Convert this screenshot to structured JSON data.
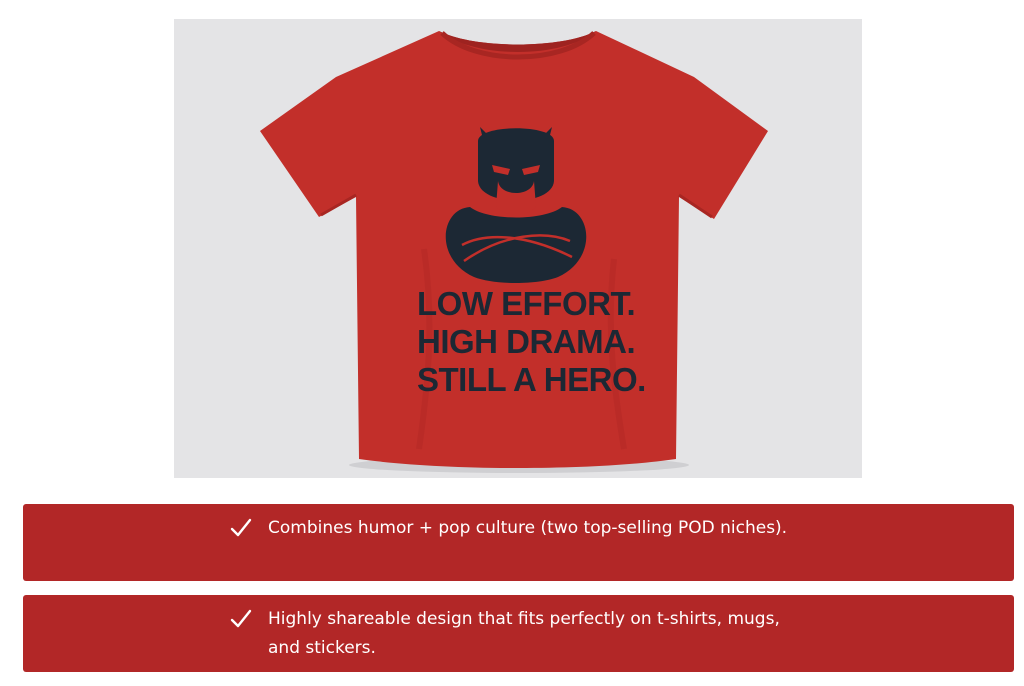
{
  "product": {
    "image_icon": "tshirt-mockup",
    "shirt_color": "#c22f2a",
    "print_color": "#1c2834",
    "print_lines": [
      "LOW EFFORT.",
      "HIGH DRAMA.",
      "STILL A HERO."
    ]
  },
  "features": [
    {
      "icon": "checkmark-icon",
      "text": "Combines humor + pop culture (two top-selling POD niches)."
    },
    {
      "icon": "checkmark-icon",
      "text": "Highly shareable design that fits perfectly on t-shirts, mugs, and stickers."
    }
  ],
  "colors": {
    "card_background": "#b22727",
    "card_text": "#ffffff",
    "image_background": "#e4e4e6"
  }
}
